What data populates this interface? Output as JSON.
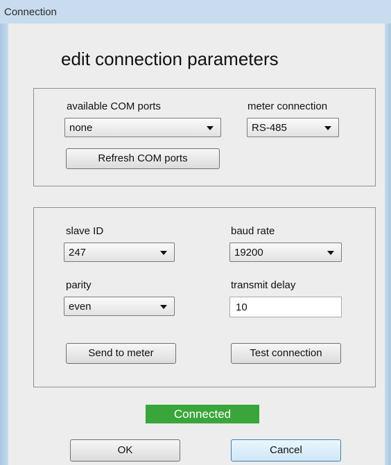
{
  "window": {
    "title": "Connection"
  },
  "heading": "edit connection parameters",
  "com_group": {
    "ports_label": "available COM ports",
    "ports_value": "none",
    "meter_label": "meter connection",
    "meter_value": "RS-485",
    "refresh_label": "Refresh COM ports"
  },
  "params_group": {
    "slave_label": "slave ID",
    "slave_value": "247",
    "baud_label": "baud rate",
    "baud_value": "19200",
    "parity_label": "parity",
    "parity_value": "even",
    "delay_label": "transmit delay",
    "delay_value": "10",
    "send_label": "Send to meter",
    "test_label": "Test connection"
  },
  "status": {
    "text": "Connected",
    "color": "#3aa53a"
  },
  "footer": {
    "ok_label": "OK",
    "cancel_label": "Cancel"
  },
  "icons": {
    "dropdown": "chevron-down-icon"
  }
}
